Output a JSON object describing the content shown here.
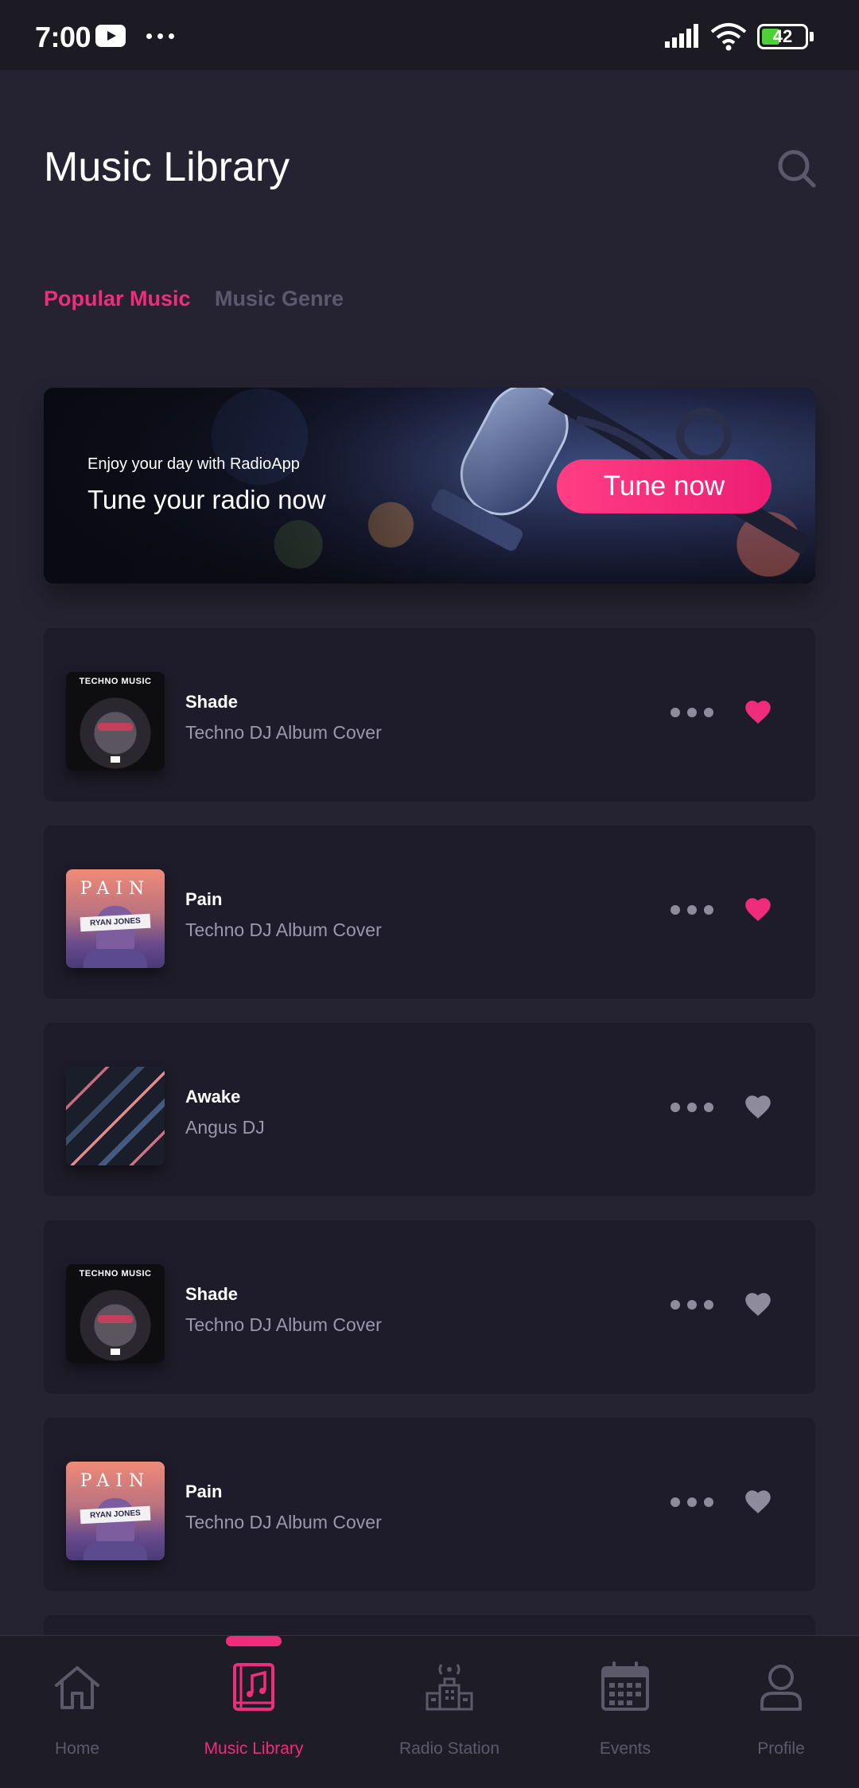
{
  "status_bar": {
    "time": "7:00",
    "battery": "42",
    "icons": [
      "youtube-icon",
      "more-dots-icon",
      "signal-icon",
      "wifi-icon",
      "battery-icon"
    ]
  },
  "header": {
    "title": "Music Library",
    "search_icon": "search-icon"
  },
  "tabs": [
    {
      "label": "Popular Music",
      "active": true
    },
    {
      "label": "Music Genre",
      "active": false
    }
  ],
  "banner": {
    "subtitle": "Enjoy your day with RadioApp",
    "title": "Tune your radio now",
    "button_label": "Tune now"
  },
  "tracks": [
    {
      "title": "Shade",
      "subtitle": "Techno DJ Album Cover",
      "cover": "techno",
      "cover_text": "TECHNO MUSIC",
      "liked": true
    },
    {
      "title": "Pain",
      "subtitle": "Techno DJ Album Cover",
      "cover": "pain",
      "cover_text": "PAIN",
      "cover_band": "RYAN JONES",
      "liked": true
    },
    {
      "title": "Awake",
      "subtitle": "Angus DJ",
      "cover": "awake",
      "liked": false
    },
    {
      "title": "Shade",
      "subtitle": "Techno DJ Album Cover",
      "cover": "techno",
      "cover_text": "TECHNO MUSIC",
      "liked": false
    },
    {
      "title": "Pain",
      "subtitle": "Techno DJ Album Cover",
      "cover": "pain",
      "cover_text": "PAIN",
      "cover_band": "RYAN JONES",
      "liked": false
    }
  ],
  "bottom_nav": [
    {
      "label": "Home",
      "icon": "home-icon",
      "active": false
    },
    {
      "label": "Music Library",
      "icon": "music-library-icon",
      "active": true
    },
    {
      "label": "Radio Station",
      "icon": "radio-station-icon",
      "active": false
    },
    {
      "label": "Events",
      "icon": "calendar-icon",
      "active": false
    },
    {
      "label": "Profile",
      "icon": "profile-icon",
      "active": false
    }
  ],
  "colors": {
    "accent": "#f02d7d",
    "background": "#252332",
    "card": "#1e1c2a",
    "muted_text": "#9a98ab",
    "heart_inactive": "#8d8b9c"
  }
}
